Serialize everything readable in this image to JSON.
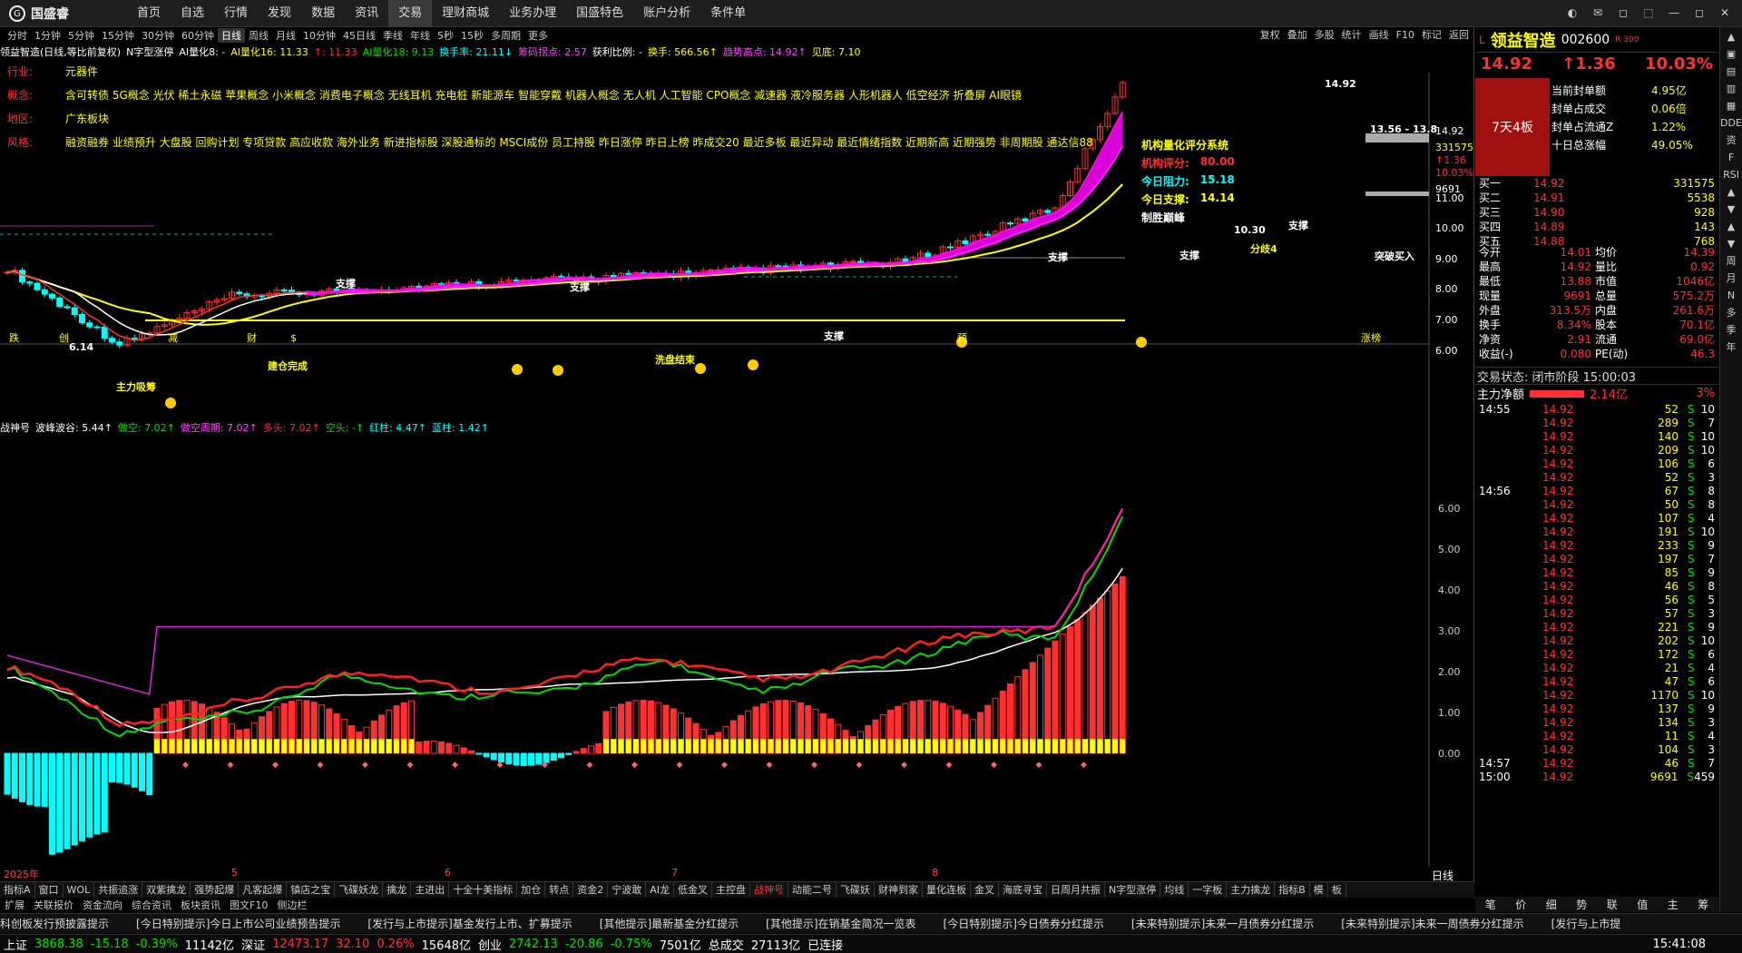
{
  "app": {
    "logo_text": "国盛睿",
    "window_controls": [
      "◐",
      "✉",
      "◻",
      "⬚",
      "—",
      "◻",
      "✕"
    ]
  },
  "nav": [
    "首页",
    "自选",
    "行情",
    "发现",
    "数据",
    "资讯",
    "交易",
    "理财商城",
    "业务办理",
    "国盛特色",
    "账户分析",
    "条件单"
  ],
  "nav_active": 6,
  "periods": [
    "分时",
    "1分钟",
    "5分钟",
    "15分钟",
    "30分钟",
    "60分钟",
    "日线",
    "周线",
    "月线",
    "10分钟",
    "45日线",
    "季线",
    "年线",
    "5秒",
    "15秒",
    "多周期",
    "更多"
  ],
  "period_selected": 6,
  "chart_tools": [
    "复权",
    "叠加",
    "多股",
    "统计",
    "画线",
    "F10",
    "标记",
    "返回"
  ],
  "infoline": [
    {
      "t": "领益智造(日线,等比前复权)",
      "c": "wht"
    },
    {
      "t": "N字型涨停",
      "c": "wht"
    },
    {
      "t": "AI量化8: -",
      "c": "wht"
    },
    {
      "t": "AI量化16: 11.33",
      "c": "yel"
    },
    {
      "t": "↑: 11.33",
      "c": "red"
    },
    {
      "t": "AI量化18: 9.13",
      "c": "grn"
    },
    {
      "t": "换手率: 21.11↓",
      "c": "cyan"
    },
    {
      "t": "筹码拐点: 2.57",
      "c": "mag"
    },
    {
      "t": "获利比例: -",
      "c": "wht"
    },
    {
      "t": "换手: 566.56↑",
      "c": "yel"
    },
    {
      "t": "趋势高点: 14.92↑",
      "c": "mag"
    },
    {
      "t": "见底: 7.10",
      "c": "yel"
    }
  ],
  "attributes": [
    {
      "label": "行业:",
      "value": "元器件"
    },
    {
      "label": "概念:",
      "value": "含可转债 5G概念 光伏 稀土永磁 苹果概念 小米概念 消费电子概念 无线耳机 充电桩 新能源车 智能穿戴 机器人概念 无人机 人工智能 CPO概念 减速器 液冷服务器 人形机器人 低空经济 折叠屏 AI眼镜"
    },
    {
      "label": "地区:",
      "value": "广东板块"
    },
    {
      "label": "风格:",
      "value": "融资融券 业绩预升 大盘股 回购计划 专项贷款 高应收款 海外业务 新进指标股 深股通标的 MSCI成份 员工持股 昨日涨停 昨日上榜 昨成交20 最近多板 最近异动 最近情绪指数 近期新高 近期强势 非周期股 通达信88"
    }
  ],
  "score_panel": {
    "title": "机构量化评分系统",
    "rating_label": "机构评分:",
    "rating": "80.00",
    "resist_label": "今日阻力:",
    "resist": "15.18",
    "support_label": "今日支撑:",
    "support": "14.14",
    "win_label": "制胜巅峰"
  },
  "chart_labels": {
    "high": "14.92",
    "low": "6.14",
    "range": "13.56 - 13.8",
    "level": "10.30",
    "breakout": "突破买入",
    "fenqi": "分歧4",
    "support": "支撑",
    "washout": "洗盘结束",
    "accum": "建仓完成",
    "mainbuy": "主力吸筹"
  },
  "price_scale": [
    "14.92",
    "331575",
    "↑1.36",
    "10.03%",
    "9691",
    "11.00",
    "10.00",
    "9.00",
    "8.00",
    "7.00",
    "6.00"
  ],
  "subindicator": [
    {
      "t": "战神号",
      "c": "wht"
    },
    {
      "t": "波峰波谷: 5.44↑",
      "c": "wht"
    },
    {
      "t": "做空: 7.02↑",
      "c": "grn"
    },
    {
      "t": "做空周期: 7.02↑",
      "c": "mag"
    },
    {
      "t": "多头: 7.02↑",
      "c": "red"
    },
    {
      "t": "空头: -↑",
      "c": "grn"
    },
    {
      "t": "红柱: 4.47↑",
      "c": "cyan"
    },
    {
      "t": "蓝柱: 1.42↑",
      "c": "cyan"
    }
  ],
  "sub_scale": [
    "6.00",
    "5.00",
    "4.00",
    "3.00",
    "2.00",
    "1.00",
    "0.00"
  ],
  "time_axis": [
    "2025年",
    "5",
    "6",
    "7",
    "8"
  ],
  "bottom_labels": [
    "跌",
    "创",
    "减",
    "财",
    "$",
    "预",
    "涨榜"
  ],
  "corner_label": "日线",
  "indicator_tabs": [
    "指标A",
    "窗口",
    "WOL",
    "共振追涨",
    "双紫擒龙",
    "强势起爆",
    "凡客起爆",
    "镇店之宝",
    "飞碟妖龙",
    "擒龙",
    "主进出",
    "十全十美指标",
    "加仓",
    "转点",
    "资金2",
    "宁波敢",
    "AI龙",
    "低金叉",
    "主控盘",
    "战神号",
    "动能二号",
    "飞碟妖",
    "财神到家",
    "量化连板",
    "金叉",
    "海底寻宝",
    "日周月共振",
    "N字型涨停",
    "均线",
    "一字板",
    "主力擒龙",
    "指标B",
    "模",
    "板"
  ],
  "indicator_tab_selected": 19,
  "bottom_tabs": [
    "扩展",
    "关联报价",
    "资金流向",
    "综合资讯",
    "板块资讯",
    "图文F10",
    "侧边栏"
  ],
  "news": [
    "科创板发行预披露提示",
    "[今日特别提示]今日上市公司业绩预告提示",
    "[发行与上市提示]基金发行上市、扩募提示",
    "[其他提示]最新基金分红提示",
    "[其他提示]在销基金简况一览表",
    "[今日特别提示]今日债券分红提示",
    "[未来特别提示]未来一月债券分红提示",
    "[未来特别提示]未来一周债券分红提示",
    "[发行与上市提"
  ],
  "status": {
    "sh_label": "上证",
    "sh": "3868.38",
    "sh_chg": "-15.18",
    "sh_pct": "-0.39%",
    "sh_amt": "11142亿",
    "sz_label": "深证",
    "sz": "12473.17",
    "sz_chg": "32.10",
    "sz_pct": "0.26%",
    "sz_amt": "15648亿",
    "cy_label": "创业",
    "cy": "2742.13",
    "cy_chg": "-20.86",
    "cy_pct": "-0.75%",
    "cy_amt": "7501亿",
    "total_label": "总成交",
    "total": "27113亿",
    "conn": "已连接",
    "time": "15:41:08"
  },
  "quote": {
    "market": "L",
    "name": "领益智造",
    "code": "002600",
    "tag": "R 300",
    "price": "14.92",
    "change": "↑1.36",
    "pct": "10.03%",
    "board": "7天4板",
    "seal": [
      {
        "k": "当前封单额",
        "v": "4.95亿"
      },
      {
        "k": "封单占成交",
        "v": "0.06倍"
      },
      {
        "k": "封单占流通Z",
        "v": "1.22%"
      },
      {
        "k": "十日总涨幅",
        "v": "49.05%"
      }
    ],
    "book": [
      {
        "k": "买一",
        "p": "14.92",
        "v": "331575"
      },
      {
        "k": "买二",
        "p": "14.91",
        "v": "5538"
      },
      {
        "k": "买三",
        "p": "14.90",
        "v": "928"
      },
      {
        "k": "买四",
        "p": "14.89",
        "v": "143"
      },
      {
        "k": "买五",
        "p": "14.88",
        "v": "768"
      }
    ],
    "stats": [
      [
        "今开",
        "14.01",
        "均价",
        "14.39"
      ],
      [
        "最高",
        "14.92",
        "量比",
        "0.92"
      ],
      [
        "最低",
        "13.88",
        "市值",
        "1046亿"
      ],
      [
        "现量",
        "9691",
        "总量",
        "575.2万"
      ],
      [
        "外盘",
        "313.5万",
        "内盘",
        "261.6万"
      ],
      [
        "换手",
        "8.34%",
        "股本",
        "70.1亿"
      ],
      [
        "净资",
        "2.91",
        "流通",
        "69.0亿"
      ],
      [
        "收益(-)",
        "0.080",
        "PE(动)",
        "46.3"
      ]
    ],
    "trade_state": "交易状态: 闭市阶段 15:00:03",
    "flow_label": "主力净额",
    "flow": "2.14亿",
    "flow_pct": "3%",
    "ticks": [
      {
        "t": "14:55",
        "p": "14.92",
        "v": "52",
        "s": "S",
        "n": "10"
      },
      {
        "t": "",
        "p": "14.92",
        "v": "289",
        "s": "S",
        "n": "7"
      },
      {
        "t": "",
        "p": "14.92",
        "v": "140",
        "s": "S",
        "n": "10"
      },
      {
        "t": "",
        "p": "14.92",
        "v": "209",
        "s": "S",
        "n": "10"
      },
      {
        "t": "",
        "p": "14.92",
        "v": "106",
        "s": "S",
        "n": "6"
      },
      {
        "t": "",
        "p": "14.92",
        "v": "52",
        "s": "S",
        "n": "3"
      },
      {
        "t": "14:56",
        "p": "14.92",
        "v": "67",
        "s": "S",
        "n": "8"
      },
      {
        "t": "",
        "p": "14.92",
        "v": "50",
        "s": "S",
        "n": "8"
      },
      {
        "t": "",
        "p": "14.92",
        "v": "107",
        "s": "S",
        "n": "4"
      },
      {
        "t": "",
        "p": "14.92",
        "v": "191",
        "s": "S",
        "n": "10"
      },
      {
        "t": "",
        "p": "14.92",
        "v": "233",
        "s": "S",
        "n": "9"
      },
      {
        "t": "",
        "p": "14.92",
        "v": "197",
        "s": "S",
        "n": "7"
      },
      {
        "t": "",
        "p": "14.92",
        "v": "85",
        "s": "S",
        "n": "9"
      },
      {
        "t": "",
        "p": "14.92",
        "v": "46",
        "s": "S",
        "n": "8"
      },
      {
        "t": "",
        "p": "14.92",
        "v": "56",
        "s": "S",
        "n": "5"
      },
      {
        "t": "",
        "p": "14.92",
        "v": "57",
        "s": "S",
        "n": "3"
      },
      {
        "t": "",
        "p": "14.92",
        "v": "221",
        "s": "S",
        "n": "9"
      },
      {
        "t": "",
        "p": "14.92",
        "v": "202",
        "s": "S",
        "n": "10"
      },
      {
        "t": "",
        "p": "14.92",
        "v": "172",
        "s": "S",
        "n": "6"
      },
      {
        "t": "",
        "p": "14.92",
        "v": "21",
        "s": "S",
        "n": "4"
      },
      {
        "t": "",
        "p": "14.92",
        "v": "47",
        "s": "S",
        "n": "6"
      },
      {
        "t": "",
        "p": "14.92",
        "v": "1170",
        "s": "S",
        "n": "10"
      },
      {
        "t": "",
        "p": "14.92",
        "v": "137",
        "s": "S",
        "n": "9"
      },
      {
        "t": "",
        "p": "14.92",
        "v": "134",
        "s": "S",
        "n": "3"
      },
      {
        "t": "",
        "p": "14.92",
        "v": "11",
        "s": "S",
        "n": "4"
      },
      {
        "t": "",
        "p": "14.92",
        "v": "104",
        "s": "S",
        "n": "3"
      },
      {
        "t": "14:57",
        "p": "14.92",
        "v": "46",
        "s": "S",
        "n": "7"
      },
      {
        "t": "15:00",
        "p": "14.92",
        "v": "9691",
        "s": "S",
        "n": "459"
      }
    ],
    "detail_tabs": [
      "笔",
      "价",
      "细",
      "势",
      "联",
      "值",
      "主",
      "筹"
    ]
  },
  "sidebar": [
    "▲",
    "▣",
    "▤",
    "▥",
    "▦",
    "DDE",
    "资",
    "F",
    "RSI",
    "▲",
    "▼",
    "▲",
    "▼",
    "周",
    "月",
    "N",
    "多",
    "季",
    "年"
  ]
}
